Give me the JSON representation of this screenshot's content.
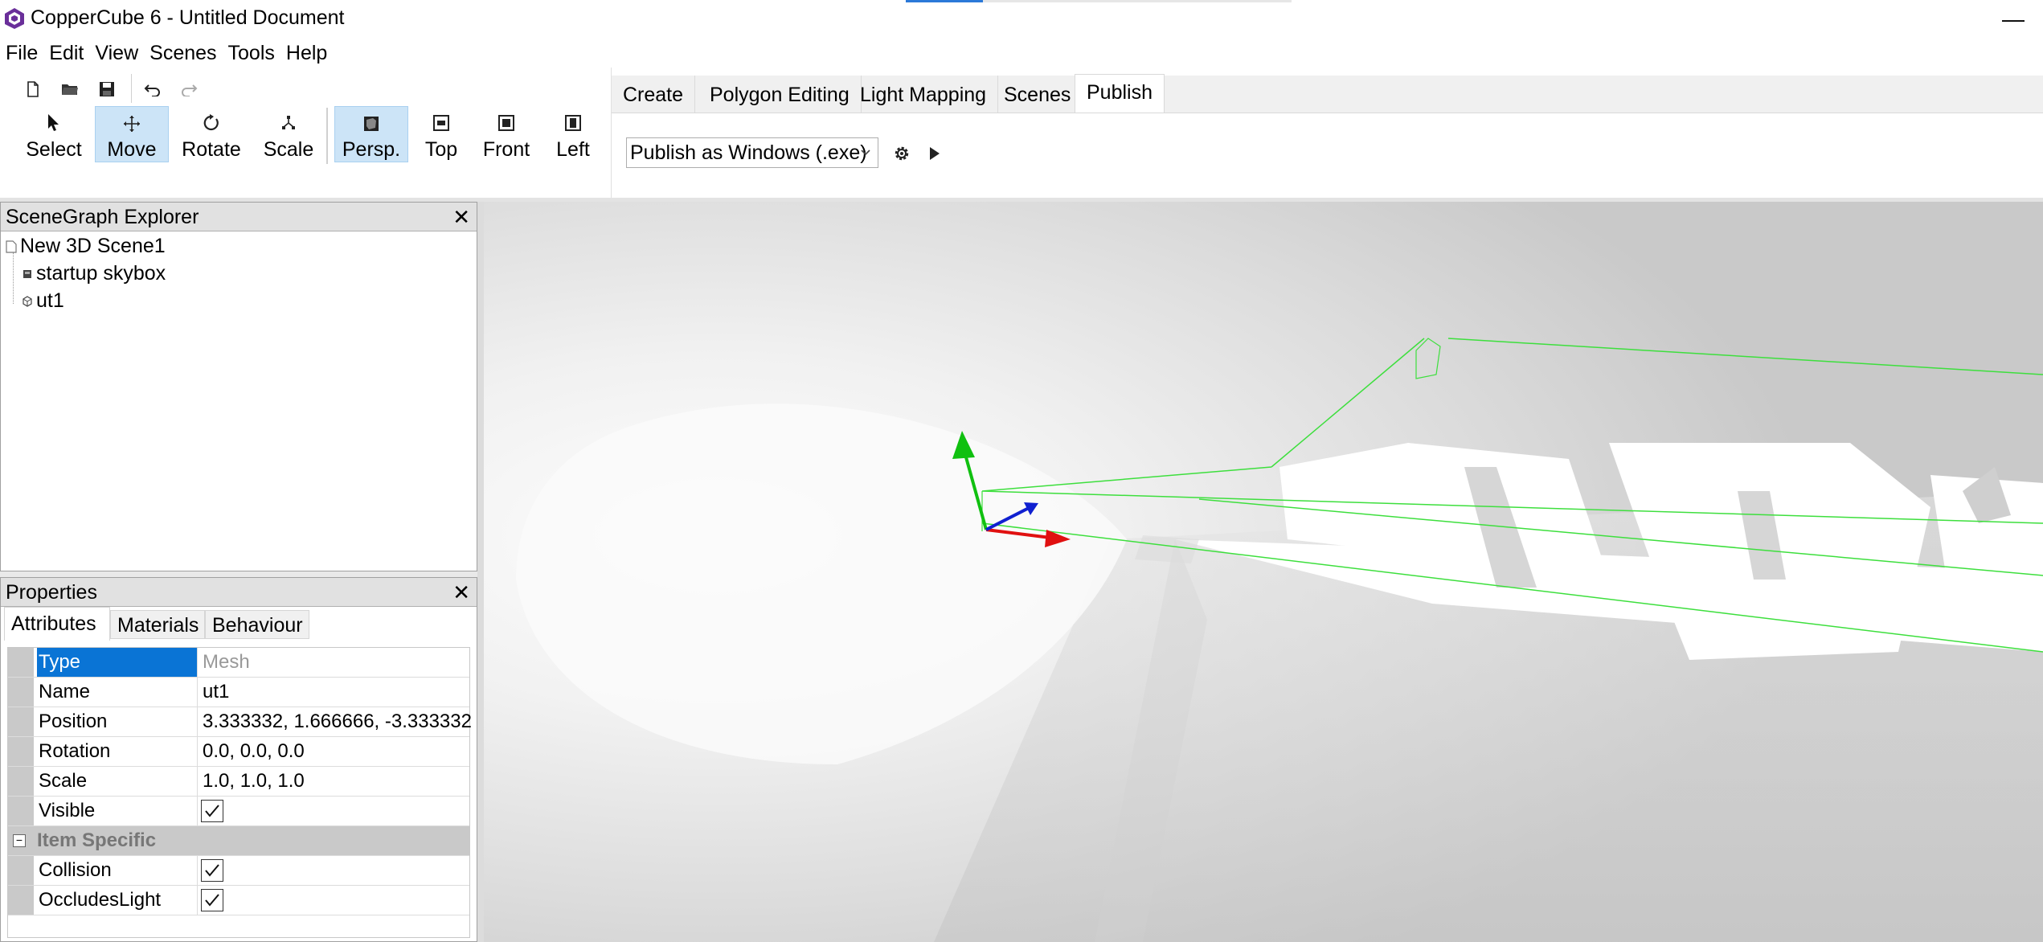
{
  "window": {
    "title": "CopperCube 6 - Untitled Document",
    "minimize_glyph": "—"
  },
  "menubar": {
    "items": [
      {
        "label": "File"
      },
      {
        "label": "Edit"
      },
      {
        "label": "View"
      },
      {
        "label": "Scenes"
      },
      {
        "label": "Tools"
      },
      {
        "label": "Help"
      }
    ]
  },
  "toolbar": {
    "quick_icons": [
      "new-document-icon",
      "open-folder-icon",
      "save-icon",
      "undo-icon",
      "redo-icon"
    ],
    "tools": [
      {
        "label": "Select",
        "icon": "cursor-arrow-icon",
        "active": false
      },
      {
        "label": "Move",
        "icon": "move-arrows-icon",
        "active": true
      },
      {
        "label": "Rotate",
        "icon": "rotate-icon",
        "active": false
      },
      {
        "label": "Scale",
        "icon": "scale-icon",
        "active": false
      }
    ],
    "views": [
      {
        "label": "Persp.",
        "icon": "perspective-view-icon",
        "active": true
      },
      {
        "label": "Top",
        "icon": "top-view-icon",
        "active": false
      },
      {
        "label": "Front",
        "icon": "front-view-icon",
        "active": false
      },
      {
        "label": "Left",
        "icon": "left-view-icon",
        "active": false
      }
    ]
  },
  "ribbon": {
    "tabs": [
      {
        "label": "Create",
        "selected": false
      },
      {
        "label": "Polygon Editing",
        "selected": false
      },
      {
        "label": "Light Mapping",
        "selected": false
      },
      {
        "label": "Scenes",
        "selected": false
      },
      {
        "label": "Publish",
        "selected": true
      }
    ],
    "publish_target": "Publish as Windows (.exe)"
  },
  "scenegraph": {
    "title": "SceneGraph Explorer",
    "close_glyph": "✕",
    "root": {
      "label": "New 3D Scene1",
      "icon": "document-icon"
    },
    "children": [
      {
        "label": "startup skybox",
        "icon": "skybox-icon"
      },
      {
        "label": "ut1",
        "icon": "mesh-icon"
      }
    ]
  },
  "properties": {
    "title": "Properties",
    "close_glyph": "✕",
    "tabs": [
      {
        "label": "Attributes",
        "selected": true
      },
      {
        "label": "Materials",
        "selected": false
      },
      {
        "label": "Behaviour",
        "selected": false
      }
    ],
    "rows": [
      {
        "name": "Type",
        "value": "Mesh"
      },
      {
        "name": "Name",
        "value": "ut1"
      },
      {
        "name": "Position",
        "value": "3.333332, 1.666666, -3.333332"
      },
      {
        "name": "Rotation",
        "value": "0.0, 0.0, 0.0"
      },
      {
        "name": "Scale",
        "value": "1.0, 1.0, 1.0"
      },
      {
        "name": "Visible",
        "checked": true
      }
    ],
    "category": {
      "label": "Item Specific",
      "toggle": "−"
    },
    "category_rows": [
      {
        "name": "Collision",
        "checked": true
      },
      {
        "name": "OccludesLight",
        "checked": true
      }
    ]
  },
  "colors": {
    "selection_blue": "#0a74d5",
    "active_tool_bg": "#cce4f7",
    "gizmo_x": "#e01010",
    "gizmo_y": "#10c010",
    "gizmo_z": "#1020d0",
    "bbox_green": "#3ddf3d"
  }
}
